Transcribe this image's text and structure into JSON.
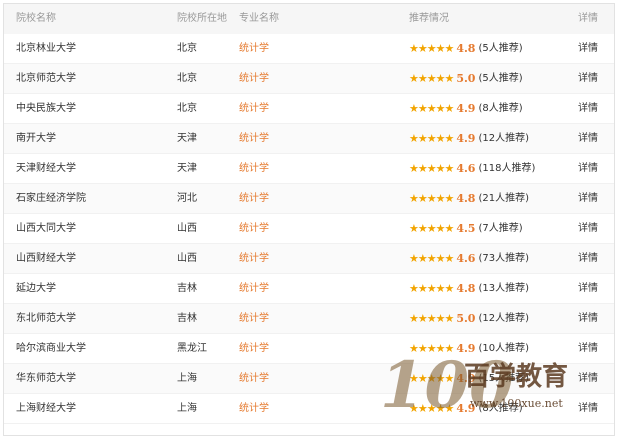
{
  "headers": {
    "school": "院校名称",
    "location": "院校所在地",
    "major": "专业名称",
    "recommend": "推荐情况",
    "detail": "详情"
  },
  "rows": [
    {
      "school": "北京林业大学",
      "location": "北京",
      "major": "统计学",
      "stars": "★★★★★",
      "score": "4.8",
      "count": "(5人推荐)",
      "detail": "详情"
    },
    {
      "school": "北京师范大学",
      "location": "北京",
      "major": "统计学",
      "stars": "★★★★★",
      "score": "5.0",
      "count": "(5人推荐)",
      "detail": "详情"
    },
    {
      "school": "中央民族大学",
      "location": "北京",
      "major": "统计学",
      "stars": "★★★★★",
      "score": "4.9",
      "count": "(8人推荐)",
      "detail": "详情"
    },
    {
      "school": "南开大学",
      "location": "天津",
      "major": "统计学",
      "stars": "★★★★★",
      "score": "4.9",
      "count": "(12人推荐)",
      "detail": "详情"
    },
    {
      "school": "天津财经大学",
      "location": "天津",
      "major": "统计学",
      "stars": "★★★★★",
      "score": "4.6",
      "count": "(118人推荐)",
      "detail": "详情"
    },
    {
      "school": "石家庄经济学院",
      "location": "河北",
      "major": "统计学",
      "stars": "★★★★★",
      "score": "4.8",
      "count": "(21人推荐)",
      "detail": "详情"
    },
    {
      "school": "山西大同大学",
      "location": "山西",
      "major": "统计学",
      "stars": "★★★★★",
      "score": "4.5",
      "count": "(7人推荐)",
      "detail": "详情"
    },
    {
      "school": "山西财经大学",
      "location": "山西",
      "major": "统计学",
      "stars": "★★★★★",
      "score": "4.6",
      "count": "(73人推荐)",
      "detail": "详情"
    },
    {
      "school": "延边大学",
      "location": "吉林",
      "major": "统计学",
      "stars": "★★★★★",
      "score": "4.8",
      "count": "(13人推荐)",
      "detail": "详情"
    },
    {
      "school": "东北师范大学",
      "location": "吉林",
      "major": "统计学",
      "stars": "★★★★★",
      "score": "5.0",
      "count": "(12人推荐)",
      "detail": "详情"
    },
    {
      "school": "哈尔滨商业大学",
      "location": "黑龙江",
      "major": "统计学",
      "stars": "★★★★★",
      "score": "4.9",
      "count": "(10人推荐)",
      "detail": "详情"
    },
    {
      "school": "华东师范大学",
      "location": "上海",
      "major": "统计学",
      "stars": "★★★★★",
      "score": "4.9",
      "count": "(15人推荐)",
      "detail": "详情"
    },
    {
      "school": "上海财经大学",
      "location": "上海",
      "major": "统计学",
      "stars": "★★★★★",
      "score": "4.9",
      "count": "(8人推荐)",
      "detail": "详情"
    }
  ],
  "watermark": {
    "number": "100",
    "brand": "百学教育",
    "url": "www.100xue.net"
  },
  "colors": {
    "accent": "#e57a2f",
    "star": "#f2a400",
    "header_bg": "#f6f6f6"
  }
}
